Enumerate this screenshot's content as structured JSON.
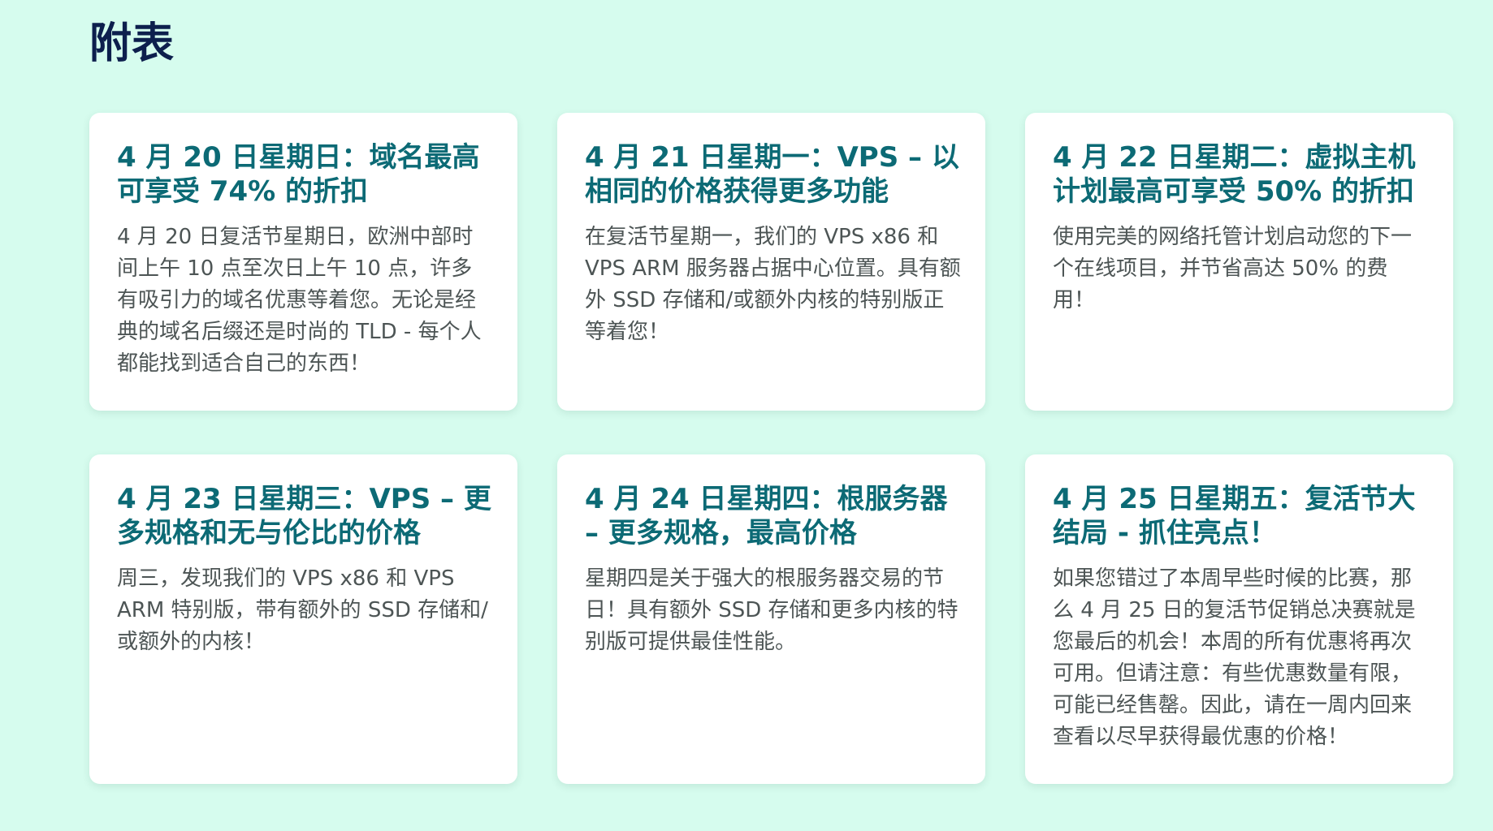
{
  "page": {
    "title": "附表",
    "colors": {
      "background": "#d6fcee",
      "title": "#0d1f4d",
      "card_title": "#0c6a75",
      "card_text": "#4d5555",
      "card_bg": "#ffffff"
    }
  },
  "cards": [
    {
      "title": "4 月 20 日星期日：域名最高可享受 74% 的折扣",
      "text": "4 月 20 日复活节星期日，欧洲中部时间上午 10 点至次日上午 10 点，许多有吸引力的域名优惠等着您。无论是经典的域名后缀还是时尚的 TLD - 每个人都能找到适合自己的东西！"
    },
    {
      "title": "4 月 21 日星期一：VPS – 以相同的价格获得更多功能",
      "text": "在复活节星期一，我们的 VPS x86 和 VPS ARM 服务器占据中心位置。具有额外 SSD 存储和/或额外内核的特别版正等着您！"
    },
    {
      "title": "4 月 22 日星期二：虚拟主机计划最高可享受 50% 的折扣",
      "text": "使用完美的网络托管计划启动您的下一个在线项目，并节省高达 50% 的费用！"
    },
    {
      "title": "4 月 23 日星期三：VPS – 更多规格和无与伦比的价格",
      "text": "周三，发现我们的 VPS x86 和 VPS ARM 特别版，带有额外的 SSD 存储和/或额外的内核！"
    },
    {
      "title": "4 月 24 日星期四：根服务器 – 更多规格，最高价格",
      "text": "星期四是关于强大的根服务器交易的节日！具有额外 SSD 存储和更多内核的特别版可提供最佳性能。"
    },
    {
      "title": "4 月 25 日星期五：复活节大结局 - 抓住亮点！",
      "text": "如果您错过了本周早些时候的比赛，那么 4 月 25 日的复活节促销总决赛就是您最后的机会！本周的所有优惠将再次可用。但请注意：有些优惠数量有限，可能已经售罄。因此，请在一周内回来查看以尽早获得最优惠的价格！"
    }
  ]
}
